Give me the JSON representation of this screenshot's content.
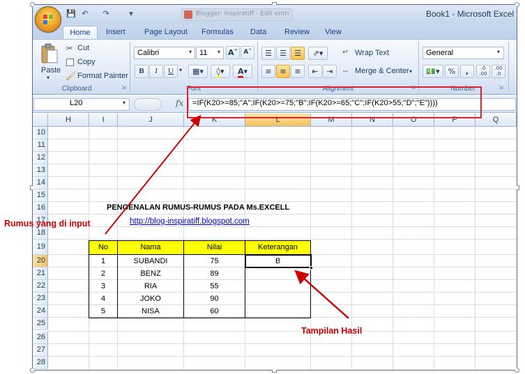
{
  "window": {
    "title": "Book1 - Microsoft Excel",
    "document_tab": "Blogger: Inspiratiff - Edit entri"
  },
  "ribbon": {
    "tabs": [
      "Home",
      "Insert",
      "Page Layout",
      "Formulas",
      "Data",
      "Review",
      "View"
    ],
    "active_tab": "Home",
    "clipboard": {
      "paste": "Paste",
      "cut": "Cut",
      "copy": "Copy",
      "format_painter": "Format Painter",
      "label": "Clipboard"
    },
    "font": {
      "name": "Calibri",
      "size": "11",
      "bold": "B",
      "italic": "I",
      "underline": "U",
      "label": "Font"
    },
    "alignment": {
      "wrap_text": "Wrap Text",
      "merge_center": "Merge & Center",
      "label": "Alignment"
    },
    "number": {
      "format": "General",
      "percent": "%",
      "comma": ",",
      "inc_decimal": ".0 .00",
      "dec_decimal": ".00 .0",
      "label": "Number"
    }
  },
  "formula_bar": {
    "name_box": "L20",
    "fx": "fx",
    "formula": "=IF(K20>=85;\"A\";IF(K20>=75;\"B\";IF(K20>=65;\"C\";IF(K20>55;\"D\";\"E\"))))"
  },
  "sheet": {
    "columns": [
      "H",
      "I",
      "J",
      "K",
      "L",
      "M",
      "N",
      "O",
      "P",
      "Q"
    ],
    "selected_column": "L",
    "rows": [
      "10",
      "11",
      "12",
      "13",
      "14",
      "15",
      "16",
      "17",
      "18",
      "19",
      "20",
      "21",
      "22",
      "23",
      "24",
      "25",
      "26",
      "27",
      "28"
    ],
    "selected_row": "20",
    "heading": "PENGENALAN RUMUS-RUMUS PADA Ms.EXCELL",
    "link": "http://blog-inspiratiff.blogspot.com",
    "table": {
      "headers": [
        "No",
        "Nama",
        "Nilai",
        "Keterangan"
      ],
      "rows": [
        [
          "1",
          "SUBANDI",
          "75",
          "B"
        ],
        [
          "2",
          "BENZ",
          "89",
          ""
        ],
        [
          "3",
          "RIA",
          "55",
          ""
        ],
        [
          "4",
          "JOKO",
          "90",
          ""
        ],
        [
          "5",
          "NISA",
          "60",
          ""
        ]
      ]
    }
  },
  "annotations": {
    "formula_note": "Rumus yang di input",
    "result_note": "Tampilan Hasil",
    "accent_color": "#cc0000"
  }
}
